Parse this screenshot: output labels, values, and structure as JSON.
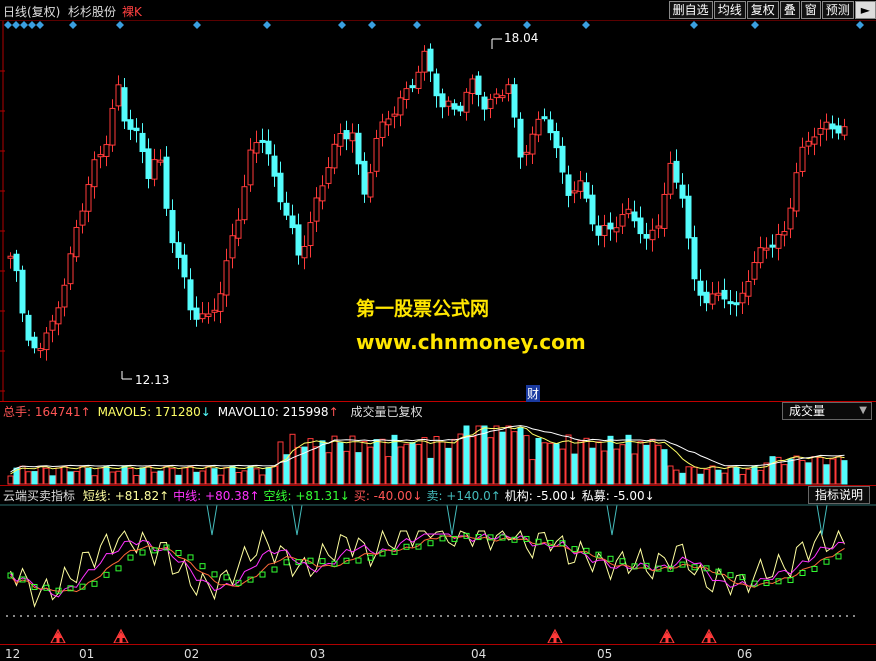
{
  "header": {
    "period": "日线(复权)",
    "stock_name": "杉杉股份",
    "mode": "裸K",
    "buttons": [
      "删自选",
      "均线",
      "复权",
      "叠",
      "窗",
      "预测"
    ],
    "play_icon": "play-arrow-icon"
  },
  "price_chart": {
    "high_label": "18.04",
    "low_label": "12.13",
    "marker_label": "财",
    "watermark_line1": "第一股票公式网",
    "watermark_line2": "www.chnmoney.com"
  },
  "volume_panel": {
    "total_label": "总手: ",
    "total_value": "164741",
    "mavol5_label": "MAVOL5: ",
    "mavol5_value": "171280",
    "mavol10_label": "MAVOL10: ",
    "mavol10_value": "215998",
    "note": "成交量已复权",
    "selector": "成交量",
    "up_arrow": "↑",
    "down_arrow": "↓"
  },
  "indicator_panel": {
    "name": "云端买卖指标",
    "fields": [
      {
        "label": "短线: ",
        "value": "+81.82",
        "arrow": "↑",
        "color": "#ffffa0"
      },
      {
        "label": "中线: ",
        "value": "+80.38",
        "arrow": "↑",
        "color": "#ff33ff"
      },
      {
        "label": "空线: ",
        "value": "+81.31",
        "arrow": "↓",
        "color": "#33ff33"
      },
      {
        "label": "买: ",
        "value": "-40.00",
        "arrow": "↓",
        "color": "#ff5555"
      },
      {
        "label": "卖: ",
        "value": "+140.0",
        "arrow": "↑",
        "color": "#44bbbb"
      },
      {
        "label": "机构: ",
        "value": "-5.00",
        "arrow": "↓",
        "color": "#ffffff"
      },
      {
        "label": "私募: ",
        "value": "-5.00",
        "arrow": "↓",
        "color": "#ffffff"
      }
    ],
    "help_button": "指标说明"
  },
  "x_axis": {
    "labels": [
      "12",
      "01",
      "02",
      "03",
      "04",
      "05",
      "06"
    ]
  },
  "colors": {
    "up": "#ff3a3a",
    "down": "#54fcfc",
    "diamond": "#3a9fe0",
    "accent_red": "#b00000"
  }
}
